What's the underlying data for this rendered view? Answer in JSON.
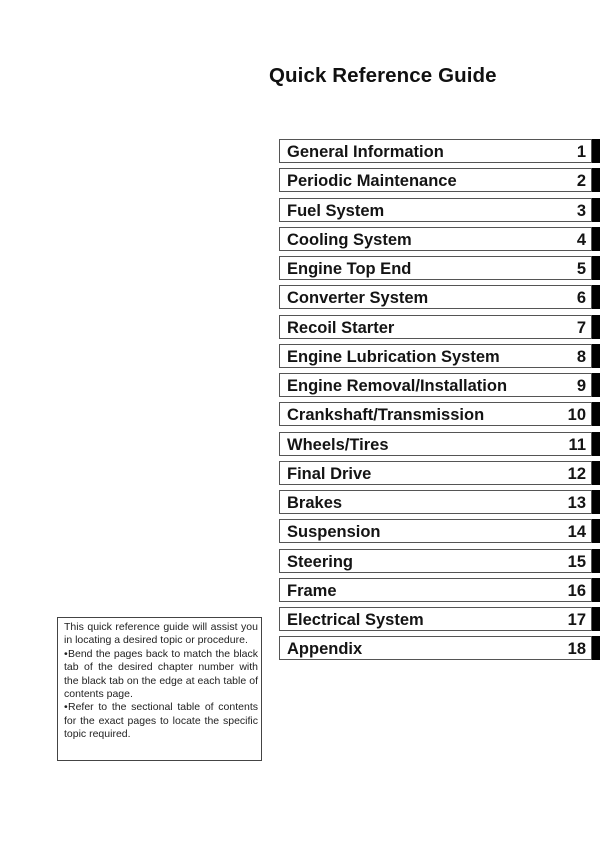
{
  "page": {
    "title": "Quick Reference Guide"
  },
  "toc": [
    {
      "label": "General Information",
      "number": "1"
    },
    {
      "label": "Periodic Maintenance",
      "number": "2"
    },
    {
      "label": "Fuel System",
      "number": "3"
    },
    {
      "label": "Cooling System",
      "number": "4"
    },
    {
      "label": "Engine Top End",
      "number": "5"
    },
    {
      "label": "Converter System",
      "number": "6"
    },
    {
      "label": "Recoil Starter",
      "number": "7"
    },
    {
      "label": "Engine Lubrication System",
      "number": "8"
    },
    {
      "label": "Engine Removal/Installation",
      "number": "9"
    },
    {
      "label": "Crankshaft/Transmission",
      "number": "10"
    },
    {
      "label": "Wheels/Tires",
      "number": "11"
    },
    {
      "label": "Final Drive",
      "number": "12"
    },
    {
      "label": "Brakes",
      "number": "13"
    },
    {
      "label": "Suspension",
      "number": "14"
    },
    {
      "label": "Steering",
      "number": "15"
    },
    {
      "label": "Frame",
      "number": "16"
    },
    {
      "label": "Electrical System",
      "number": "17"
    },
    {
      "label": "Appendix",
      "number": "18"
    }
  ],
  "note": {
    "intro": "This quick reference guide will assist you in locating a desired topic or procedure.",
    "bullets": [
      "Bend the pages back to match the black tab of the desired chapter number with the black tab on the edge at each table of contents page.",
      "Refer to the sectional table of contents for the exact pages to locate the specific topic required."
    ],
    "bullet_glyph": "•"
  }
}
